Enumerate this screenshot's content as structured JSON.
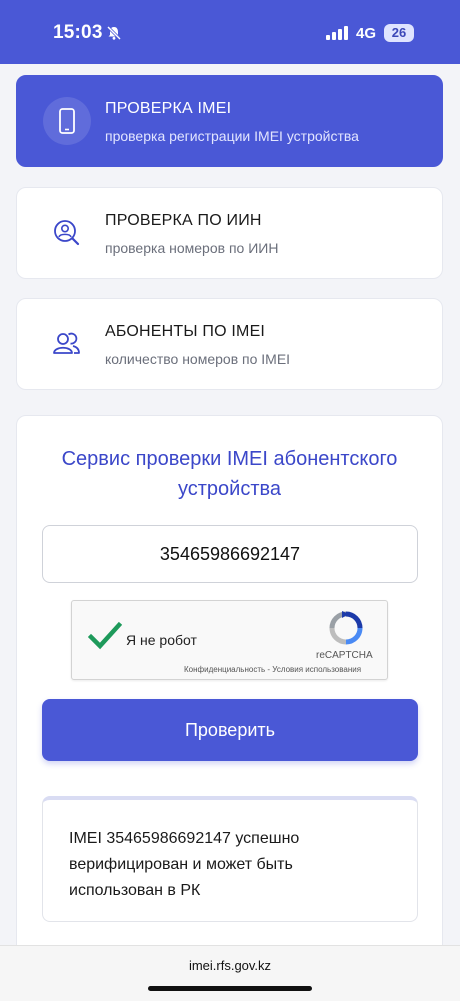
{
  "status_bar": {
    "time": "15:03",
    "network": "4G",
    "battery": "26"
  },
  "menu": [
    {
      "title": "ПРОВЕРКА IMEI",
      "subtitle": "проверка регистрации IMEI устройства",
      "icon": "phone-icon",
      "active": true
    },
    {
      "title": "ПРОВЕРКА ПО ИИН",
      "subtitle": "проверка номеров по ИИН",
      "icon": "user-search-icon",
      "active": false
    },
    {
      "title": "АБОНЕНТЫ ПО IMEI",
      "subtitle": "количество номеров по IMEI",
      "icon": "users-icon",
      "active": false
    }
  ],
  "service": {
    "title": "Сервис проверки IMEI абонентского устройства",
    "imei_value": "35465986692147",
    "check_button": "Проверить",
    "result": "IMEI 35465986692147 успешно верифицирован и может быть использован в РК"
  },
  "captcha": {
    "label": "Я не робот",
    "brand": "reCAPTCHA",
    "privacy": "Конфиденциальность",
    "separator": " - ",
    "terms": "Условия использования"
  },
  "browser": {
    "url": "imei.rfs.gov.kz"
  },
  "colors": {
    "primary": "#4a58d6",
    "title": "#3b47c9",
    "check": "#1e9a5b"
  }
}
